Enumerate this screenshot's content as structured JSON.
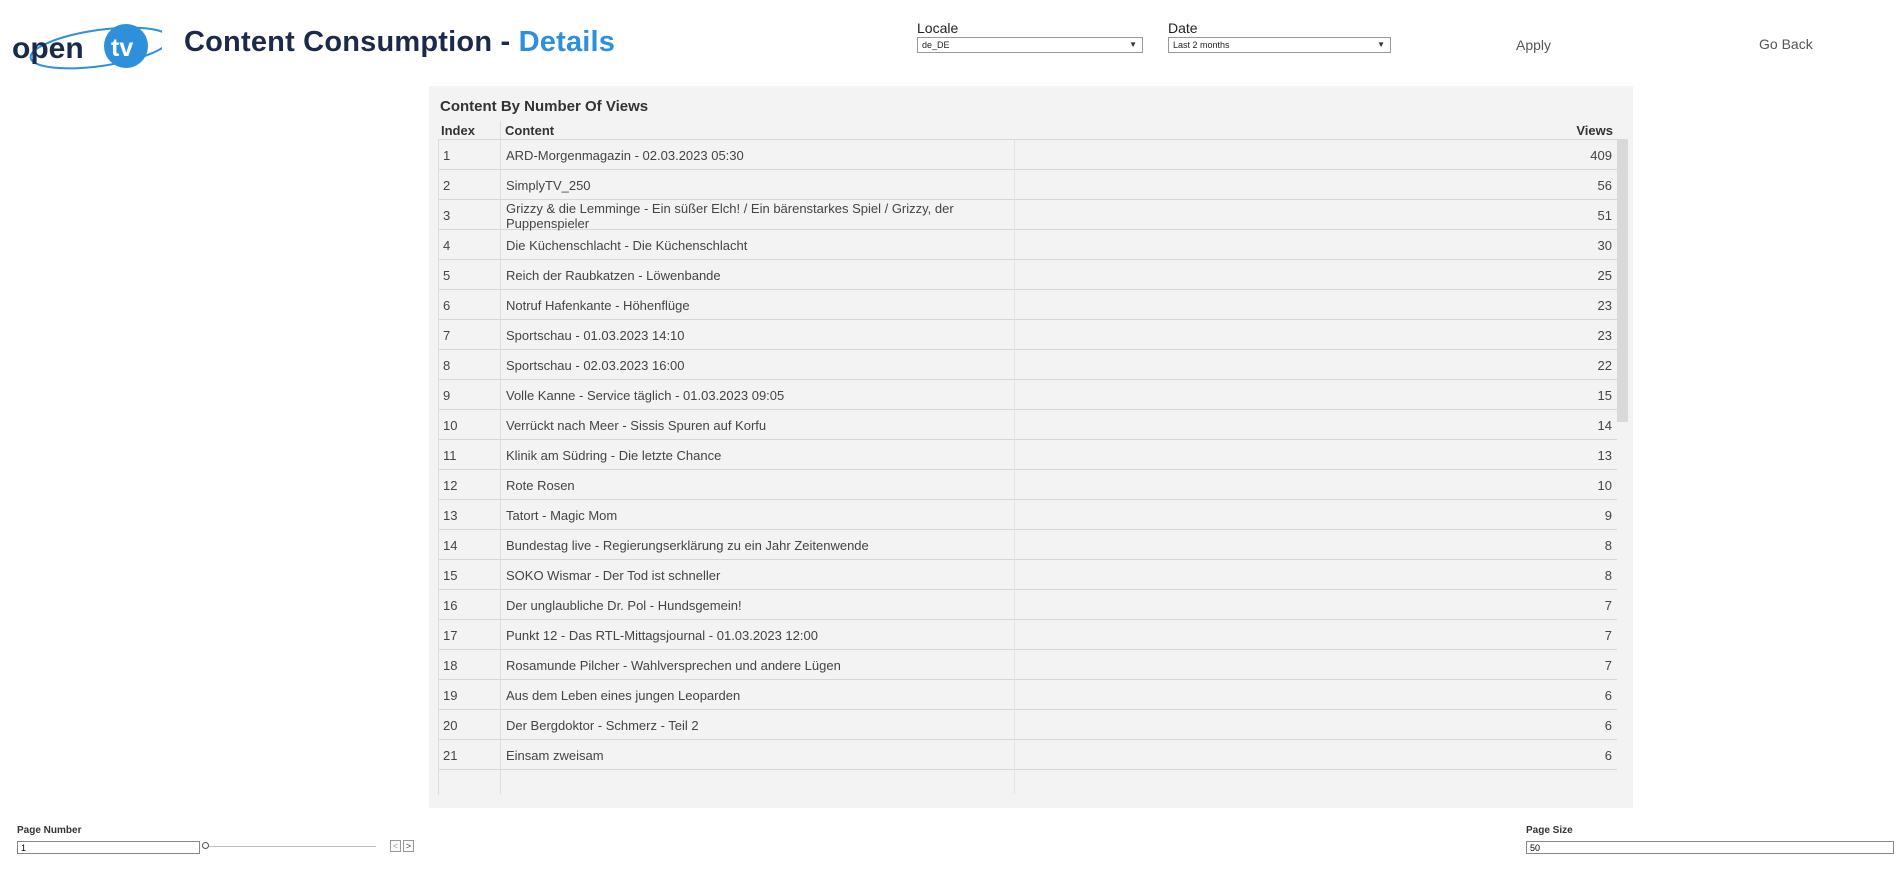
{
  "header": {
    "logo_text": "opentv",
    "title_main": "Content Consumption - ",
    "title_accent": "Details",
    "locale_label": "Locale",
    "locale_value": "de_DE",
    "date_label": "Date",
    "date_value": "Last 2 months",
    "apply_label": "Apply",
    "back_label": "Go Back"
  },
  "table": {
    "title": "Content By Number Of Views",
    "columns": {
      "index": "Index",
      "content": "Content",
      "views": "Views"
    },
    "rows": [
      {
        "index": "1",
        "content": "ARD-Morgenmagazin - 02.03.2023 05:30",
        "views": "409"
      },
      {
        "index": "2",
        "content": "SimplyTV_250",
        "views": "56"
      },
      {
        "index": "3",
        "content": "Grizzy & die Lemminge - Ein süßer Elch! / Ein bärenstarkes Spiel / Grizzy, der Puppenspieler",
        "views": "51"
      },
      {
        "index": "4",
        "content": "Die Küchenschlacht - Die Küchenschlacht",
        "views": "30"
      },
      {
        "index": "5",
        "content": "Reich der Raubkatzen - Löwenbande",
        "views": "25"
      },
      {
        "index": "6",
        "content": "Notruf Hafenkante - Höhenflüge",
        "views": "23"
      },
      {
        "index": "7",
        "content": "Sportschau - 01.03.2023 14:10",
        "views": "23"
      },
      {
        "index": "8",
        "content": "Sportschau - 02.03.2023 16:00",
        "views": "22"
      },
      {
        "index": "9",
        "content": "Volle Kanne - Service täglich - 01.03.2023 09:05",
        "views": "15"
      },
      {
        "index": "10",
        "content": "Verrückt nach Meer - Sissis Spuren auf Korfu",
        "views": "14"
      },
      {
        "index": "11",
        "content": "Klinik am Südring - Die letzte Chance",
        "views": "13"
      },
      {
        "index": "12",
        "content": "Rote Rosen",
        "views": "10"
      },
      {
        "index": "13",
        "content": "Tatort - Magic Mom",
        "views": "9"
      },
      {
        "index": "14",
        "content": "Bundestag live - Regierungserklärung zu ein Jahr Zeitenwende",
        "views": "8"
      },
      {
        "index": "15",
        "content": "SOKO Wismar - Der Tod ist schneller",
        "views": "8"
      },
      {
        "index": "16",
        "content": "Der unglaubliche Dr. Pol - Hundsgemein!",
        "views": "7"
      },
      {
        "index": "17",
        "content": "Punkt 12 - Das RTL-Mittagsjournal - 01.03.2023 12:00",
        "views": "7"
      },
      {
        "index": "18",
        "content": "Rosamunde Pilcher - Wahlversprechen und andere Lügen",
        "views": "7"
      },
      {
        "index": "19",
        "content": "Aus dem Leben eines jungen Leoparden",
        "views": "6"
      },
      {
        "index": "20",
        "content": "Der Bergdoktor - Schmerz - Teil 2",
        "views": "6"
      },
      {
        "index": "21",
        "content": "Einsam zweisam",
        "views": "6"
      }
    ]
  },
  "footer": {
    "page_number_label": "Page Number",
    "page_number_value": "1",
    "page_size_label": "Page Size",
    "page_size_value": "50",
    "prev_glyph": "<",
    "next_glyph": ">"
  },
  "colors": {
    "title_dark": "#1b2a4a",
    "title_accent": "#2e8fdb",
    "logo_blue": "#2e8fdb",
    "panel_bg": "#f3f3f3"
  }
}
